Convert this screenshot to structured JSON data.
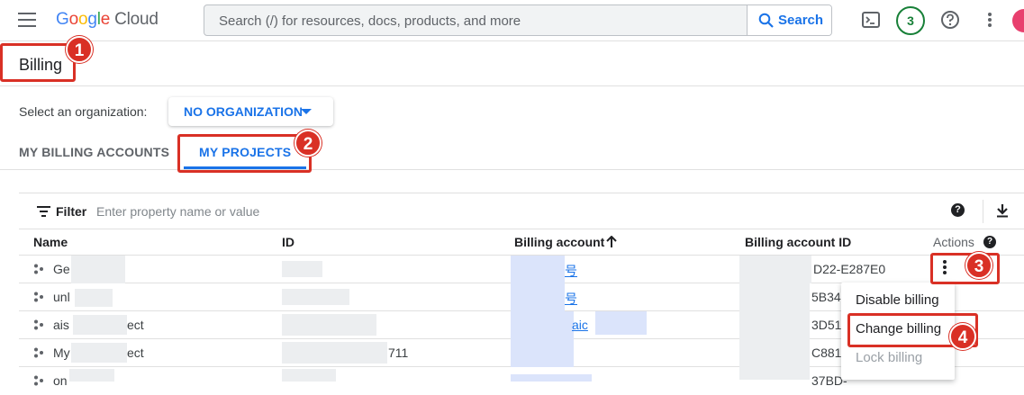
{
  "topbar": {
    "logo_google": [
      "G",
      "o",
      "o",
      "g",
      "l",
      "e"
    ],
    "logo_product": "Cloud",
    "search_placeholder": "Search (/) for resources, docs, products, and more",
    "search_button": "Search",
    "notification_count": "3"
  },
  "page": {
    "title": "Billing"
  },
  "organization": {
    "label": "Select an organization:",
    "value": "NO ORGANIZATION"
  },
  "tabs": [
    {
      "label": "MY BILLING ACCOUNTS",
      "active": false
    },
    {
      "label": "MY PROJECTS",
      "active": true
    }
  ],
  "filter": {
    "label": "Filter",
    "placeholder": "Enter property name or value"
  },
  "table": {
    "columns": [
      "Name",
      "ID",
      "Billing account",
      "Billing account ID",
      "Actions"
    ],
    "rows": [
      {
        "name": "Ge",
        "id_suffix": "",
        "billing_account": "号",
        "billing_account_id": "D22-E287E0"
      },
      {
        "name": "unl",
        "id_suffix": "",
        "billing_account": "号",
        "billing_account_id": "5B34-"
      },
      {
        "name": "ais",
        "name_suffix": "ect",
        "id_suffix": "",
        "billing_account": "aic",
        "billing_account_id": "3D51-"
      },
      {
        "name": "My",
        "name_suffix": "ect",
        "id_suffix": "711",
        "billing_account": "",
        "billing_account_id": "C881-3"
      },
      {
        "name": "on",
        "id_suffix": "",
        "billing_account": "",
        "billing_account_id": "37BD-"
      }
    ]
  },
  "actions_menu": {
    "items": [
      {
        "label": "Disable billing",
        "enabled": true
      },
      {
        "label": "Change billing",
        "enabled": true
      },
      {
        "label": "Lock billing",
        "enabled": false
      }
    ]
  },
  "annotations": [
    "1",
    "2",
    "3",
    "4"
  ],
  "colors": {
    "accent": "#1a73e8",
    "annotation": "#d93025",
    "badge": "#188038"
  }
}
